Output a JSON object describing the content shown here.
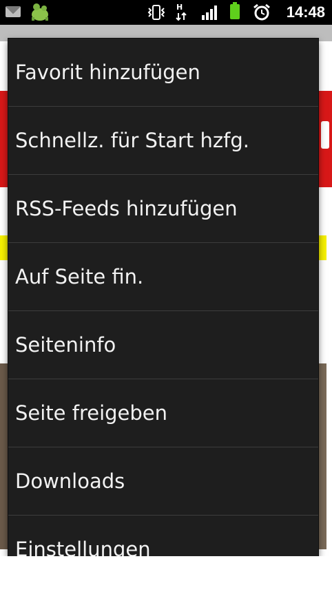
{
  "status_bar": {
    "time": "14:48",
    "icons": [
      "mail-icon",
      "android-icon",
      "vibrate-icon",
      "hspa-icon",
      "signal-icon",
      "battery-icon",
      "alarm-icon"
    ],
    "battery_color": "#5fcf1c"
  },
  "menu": {
    "items": [
      {
        "label": "Favorit hinzufügen"
      },
      {
        "label": "Schnellz. für Start hzfg."
      },
      {
        "label": "RSS-Feeds hinzufügen"
      },
      {
        "label": "Auf Seite fin."
      },
      {
        "label": "Seiteninfo"
      },
      {
        "label": "Seite freigeben"
      },
      {
        "label": "Downloads"
      },
      {
        "label": "Einstellungen"
      }
    ]
  },
  "colors": {
    "menu_bg": "#1e1e1e",
    "menu_text": "#f2f2f2",
    "divider": "#3d3d3d",
    "page_accent_red": "#d81818",
    "page_accent_yellow": "#f6f000"
  }
}
